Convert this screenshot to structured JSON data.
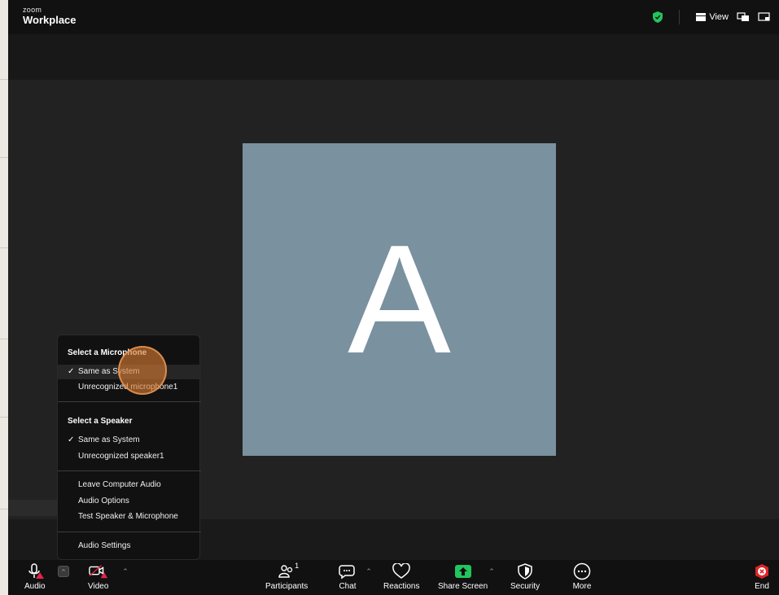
{
  "app": {
    "brand_small": "zoom",
    "brand_big": "Workplace",
    "view_label": "View"
  },
  "participant": {
    "initial": "A",
    "tile_color": "#7a919f"
  },
  "audio_menu": {
    "microphone_header": "Select a Microphone",
    "microphones": [
      {
        "label": "Same as System",
        "selected": true
      },
      {
        "label": "Unrecognized microphone1",
        "selected": false
      }
    ],
    "speaker_header": "Select a Speaker",
    "speakers": [
      {
        "label": "Same as System",
        "selected": true
      },
      {
        "label": "Unrecognized speaker1",
        "selected": false
      }
    ],
    "actions": [
      "Leave Computer Audio",
      "Audio Options",
      "Test Speaker & Microphone"
    ],
    "settings": "Audio Settings",
    "check_glyph": "✓"
  },
  "toolbar": {
    "audio": "Audio",
    "video": "Video",
    "participants": "Participants",
    "participants_count": "1",
    "chat": "Chat",
    "reactions": "Reactions",
    "share_screen": "Share Screen",
    "security": "Security",
    "more": "More",
    "end": "End"
  },
  "colors": {
    "accent_green": "#22c55e",
    "warning_red": "#e5234a",
    "end_red": "#e02424",
    "cursor_highlight": "#d67c34"
  },
  "icons": [
    "shield-icon",
    "view-icon",
    "minimize-icon",
    "pip-icon",
    "microphone-icon",
    "video-off-icon",
    "participants-icon",
    "chat-icon",
    "heart-icon",
    "share-screen-icon",
    "security-icon",
    "more-icon",
    "end-icon",
    "check-icon"
  ]
}
